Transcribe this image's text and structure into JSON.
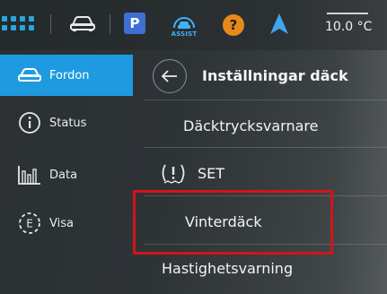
{
  "statusbar": {
    "temperature": "10.0 °C",
    "parking_label": "P",
    "assist_label": "ASSIST",
    "help_label": "?",
    "icons": [
      "apps-grid-icon",
      "car-icon",
      "parking-icon",
      "assist-icon",
      "help-icon",
      "navigation-icon"
    ]
  },
  "sidebar": {
    "items": [
      {
        "label": "Fordon",
        "icon": "car-icon",
        "active": true
      },
      {
        "label": "Status",
        "icon": "info-icon",
        "active": false
      },
      {
        "label": "Data",
        "icon": "bar-chart-icon",
        "active": false
      },
      {
        "label": "Visa",
        "icon": "eye-icon",
        "active": false
      }
    ]
  },
  "main": {
    "title": "Inställningar däck",
    "items": [
      {
        "label": "Däcktrycksvarnare"
      },
      {
        "label": "SET",
        "icon": "tire-pressure-warning-icon"
      },
      {
        "label": "Vinterdäck"
      },
      {
        "label": "Hastighetsvarning"
      }
    ]
  },
  "colors": {
    "accent": "#1e9be0",
    "highlight_box": "#d2141a",
    "parking_badge": "#3f6fd0",
    "help_badge": "#e8891c",
    "assist": "#3fb3ff"
  }
}
